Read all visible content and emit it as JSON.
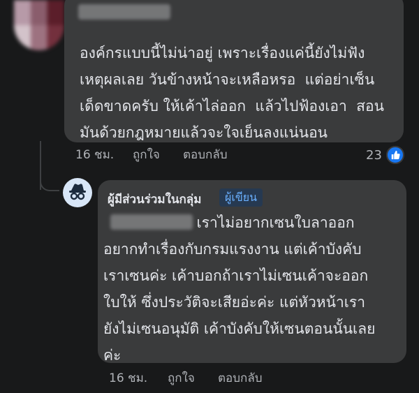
{
  "comment": {
    "text": "องค์กรแบบนี้ไม่น่าอยู่ เพราะเรื่องแค่นี้ยังไม่ฟัง\nเหตุผลเลย วันข้างหน้าจะเหลือหรอ  แต่อย่าเซ็น\nเด็ดขาดครับ ให้เค้าไล่ออก  แล้วไปฟ้องเอา  สอน\nมันด้วยกฎหมายแล้วจะใจเย็นลงแน่นอน",
    "time": "16 ชม.",
    "like_label": "ถูกใจ",
    "reply_label": "ตอบกลับ",
    "reaction_count": "23",
    "reaction_icon": "thumbs-up-icon",
    "reaction_color": "#1877f2"
  },
  "reply": {
    "author": "ผู้มีส่วนร่วมในกลุ่ม",
    "badge": "ผู้เขียน",
    "avatar_icon": "anonymous-icon",
    "text": "                    เราไม่อยากเซนใบลาออก\nอยากทำเรื่องกับกรมแรงงาน แต่เค้าบังคับ\nเราเซนค่ะ เค้าบอกถ้าเราไม่เซนเค้าจะออก\nใบให้ ซึ่งประวัติจะเสียอ่ะค่ะ แต่หัวหน้าเรา\nยังไม่เซนอนุมัติ เค้าบังคับให้เซนตอนนั้นเลย\nค่ะ",
    "time": "16 ชม.",
    "like_label": "ถูกใจ",
    "reply_label": "ตอบกลับ"
  }
}
